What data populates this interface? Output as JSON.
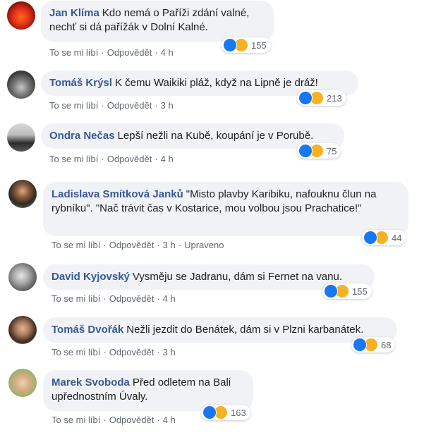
{
  "comments": [
    {
      "author": "Jan Klíma",
      "text": "Kdo nemá o Paříži zdání valné, nechť si dá pařížák v Dolní Kalné.",
      "like": "To se mi líbí",
      "reply": "Odpovědět",
      "time": "4 h",
      "edited": "",
      "reactions": "155"
    },
    {
      "author": "Tomáš Krýsl",
      "text": "K čemu Waikiki pláž, když na Lipně je dráž!",
      "like": "To se mi líbí",
      "reply": "Odpovědět",
      "time": "3 h",
      "edited": "",
      "reactions": "213"
    },
    {
      "author": "Ondra Nečas",
      "text": "Lepší nežli na Kubě, koupání je v Porubě.",
      "like": "To se mi líbí",
      "reply": "Odpovědět",
      "time": "4 h",
      "edited": "",
      "reactions": "75"
    },
    {
      "author": "Ladislava Smítková Janků",
      "text": "\"Misto plavby Karibiku, nafouknu člun na rybníku\". \"Nač trávit čas v Kostarice, mou volbou jsou Prachatice!\"",
      "like": "To se mi líbí",
      "reply": "Odpovědět",
      "time": "3 h",
      "edited": "Upraveno",
      "reactions": "44"
    },
    {
      "author": "David Kyjovský",
      "text": "Vysměju se Jadranu, dám si Fernet na vanu.",
      "like": "To se mi líbí",
      "reply": "Odpovědět",
      "time": "4 h",
      "edited": "",
      "reactions": "155"
    },
    {
      "author": "Tomáš Dvořák",
      "text": "Nežli jezdit do Benátek, dám si v Plzni karbanátek.",
      "like": "To se mi líbí",
      "reply": "Odpovědět",
      "time": "3 h",
      "edited": "",
      "reactions": "68"
    },
    {
      "author": "Marek Svoboda",
      "text": "Před odletem na Bali upřednostním Úvaly.",
      "like": "To se mi líbí",
      "reply": "Odpovědět",
      "time": "4 h",
      "edited": "",
      "reactions": "163"
    }
  ],
  "colors": {
    "author": "#385898",
    "bubble": "#f0f2f5",
    "like": "#1877f2",
    "haha": "#f7b125",
    "meta": "#606770"
  },
  "icons": [
    "like-reaction-icon",
    "haha-reaction-icon"
  ]
}
